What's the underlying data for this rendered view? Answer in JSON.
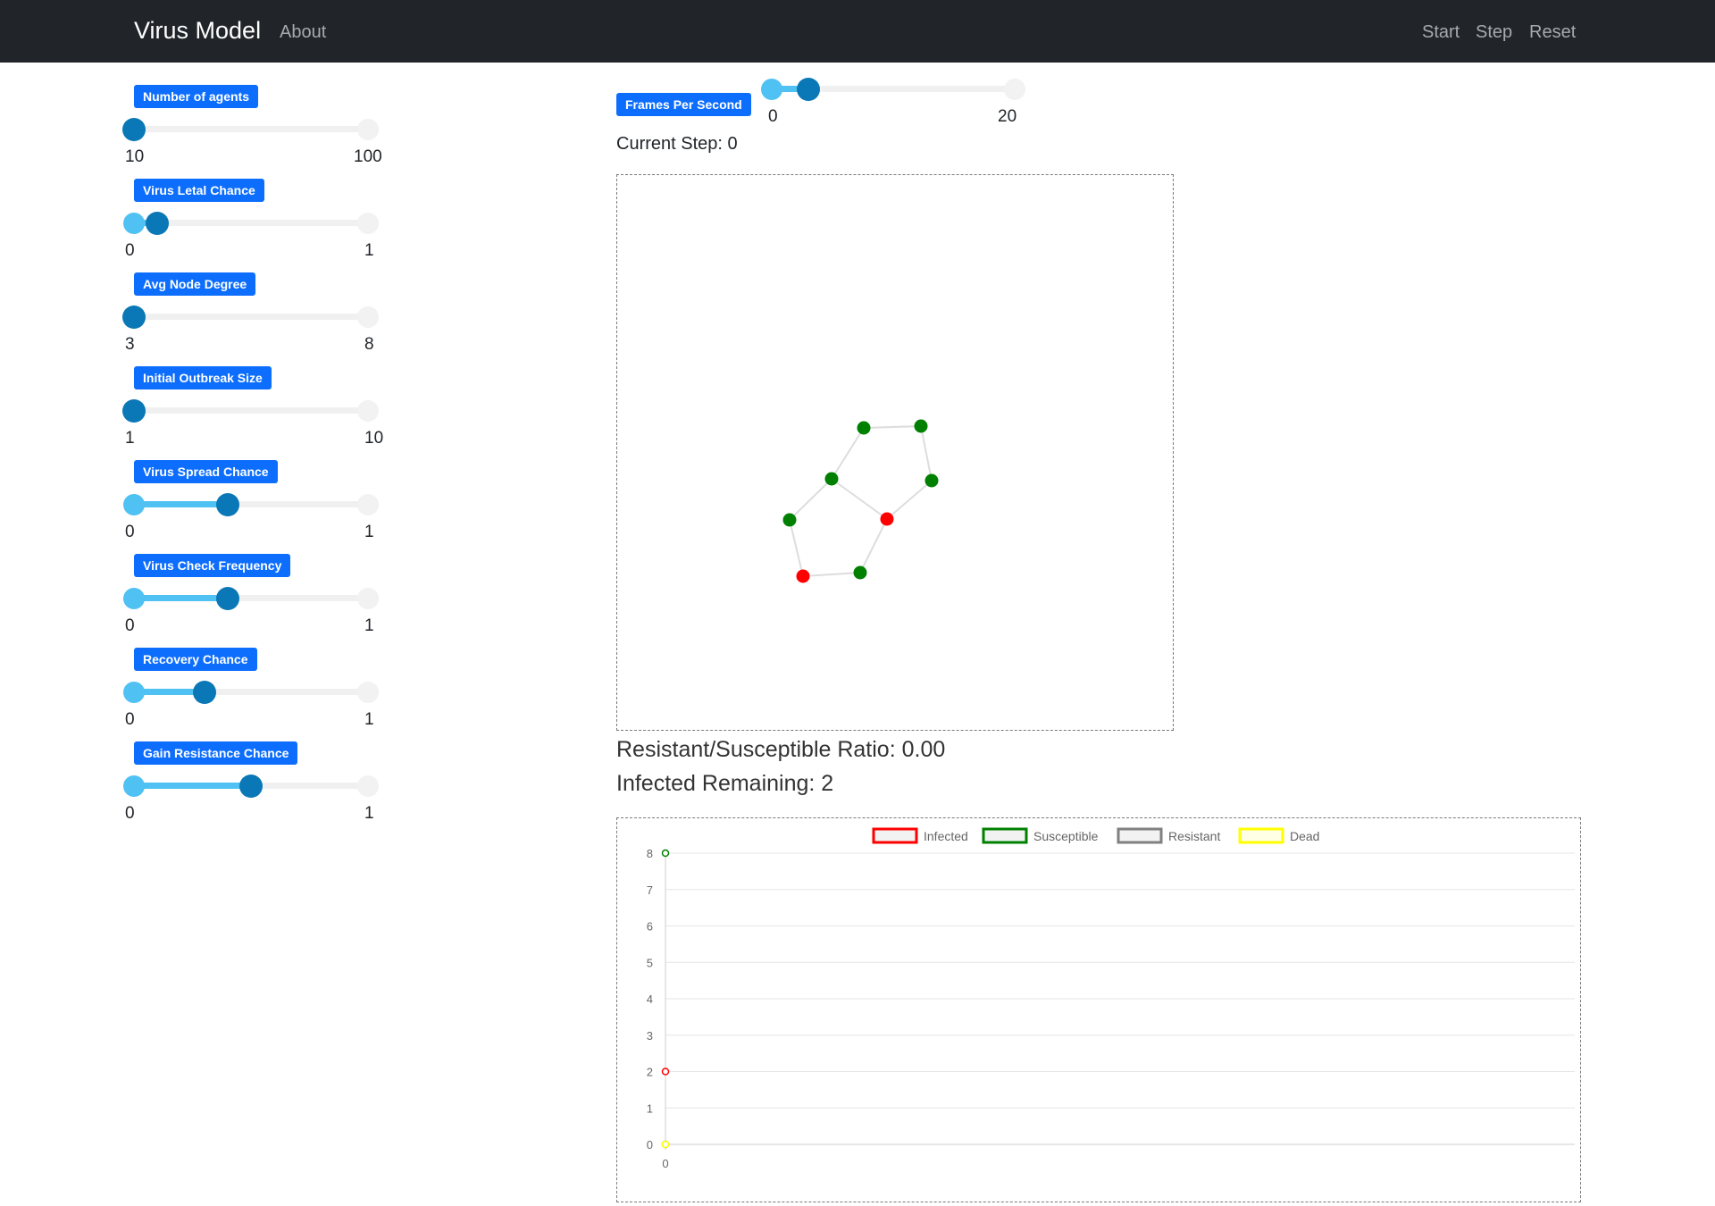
{
  "nav": {
    "brand": "Virus Model",
    "about": "About",
    "start": "Start",
    "step": "Step",
    "reset": "Reset"
  },
  "sliders": [
    {
      "label": "Number of agents",
      "min": "10",
      "max": "100",
      "value_fraction": 0.0
    },
    {
      "label": "Virus Letal Chance",
      "min": "0",
      "max": "1",
      "value_fraction": 0.1
    },
    {
      "label": "Avg Node Degree",
      "min": "3",
      "max": "8",
      "value_fraction": 0.0
    },
    {
      "label": "Initial Outbreak Size",
      "min": "1",
      "max": "10",
      "value_fraction": 0.0
    },
    {
      "label": "Virus Spread Chance",
      "min": "0",
      "max": "1",
      "value_fraction": 0.4
    },
    {
      "label": "Virus Check Frequency",
      "min": "0",
      "max": "1",
      "value_fraction": 0.4
    },
    {
      "label": "Recovery Chance",
      "min": "0",
      "max": "1",
      "value_fraction": 0.3
    },
    {
      "label": "Gain Resistance Chance",
      "min": "0",
      "max": "1",
      "value_fraction": 0.5
    }
  ],
  "fps": {
    "label": "Frames Per Second",
    "min": "0",
    "max": "20",
    "value_fraction": 0.15
  },
  "status": {
    "current_step": "Current Step: 0",
    "ratio": "Resistant/Susceptible Ratio: 0.00",
    "infected_remaining": "Infected Remaining: 2"
  },
  "network": {
    "nodes": [
      {
        "id": 1,
        "state": "susceptible"
      },
      {
        "id": 2,
        "state": "susceptible"
      },
      {
        "id": 3,
        "state": "susceptible"
      },
      {
        "id": 4,
        "state": "susceptible"
      },
      {
        "id": 5,
        "state": "infected"
      },
      {
        "id": 6,
        "state": "susceptible"
      },
      {
        "id": 7,
        "state": "infected"
      },
      {
        "id": 8,
        "state": "susceptible"
      }
    ],
    "edges": [
      [
        1,
        2
      ],
      [
        1,
        3
      ],
      [
        2,
        4
      ],
      [
        3,
        5
      ],
      [
        3,
        6
      ],
      [
        4,
        5
      ],
      [
        5,
        8
      ],
      [
        6,
        7
      ],
      [
        7,
        8
      ]
    ],
    "colors": {
      "infected": "#ff0000",
      "susceptible": "#008000",
      "edge": "#dddddd"
    }
  },
  "chart_data": {
    "type": "line",
    "legend_position": "top",
    "grid": true,
    "x": [
      0
    ],
    "x_ticks": [
      "0"
    ],
    "ylim": [
      0,
      8
    ],
    "y_ticks": [
      "0",
      "1",
      "2",
      "3",
      "4",
      "5",
      "6",
      "7",
      "8"
    ],
    "series": [
      {
        "name": "Infected",
        "values": [
          2
        ],
        "color": "#ff0000"
      },
      {
        "name": "Susceptible",
        "values": [
          8
        ],
        "color": "#008000"
      },
      {
        "name": "Resistant",
        "values": [
          0
        ],
        "color": "#808080"
      },
      {
        "name": "Dead",
        "values": [
          0
        ],
        "color": "#ffff00"
      }
    ]
  }
}
